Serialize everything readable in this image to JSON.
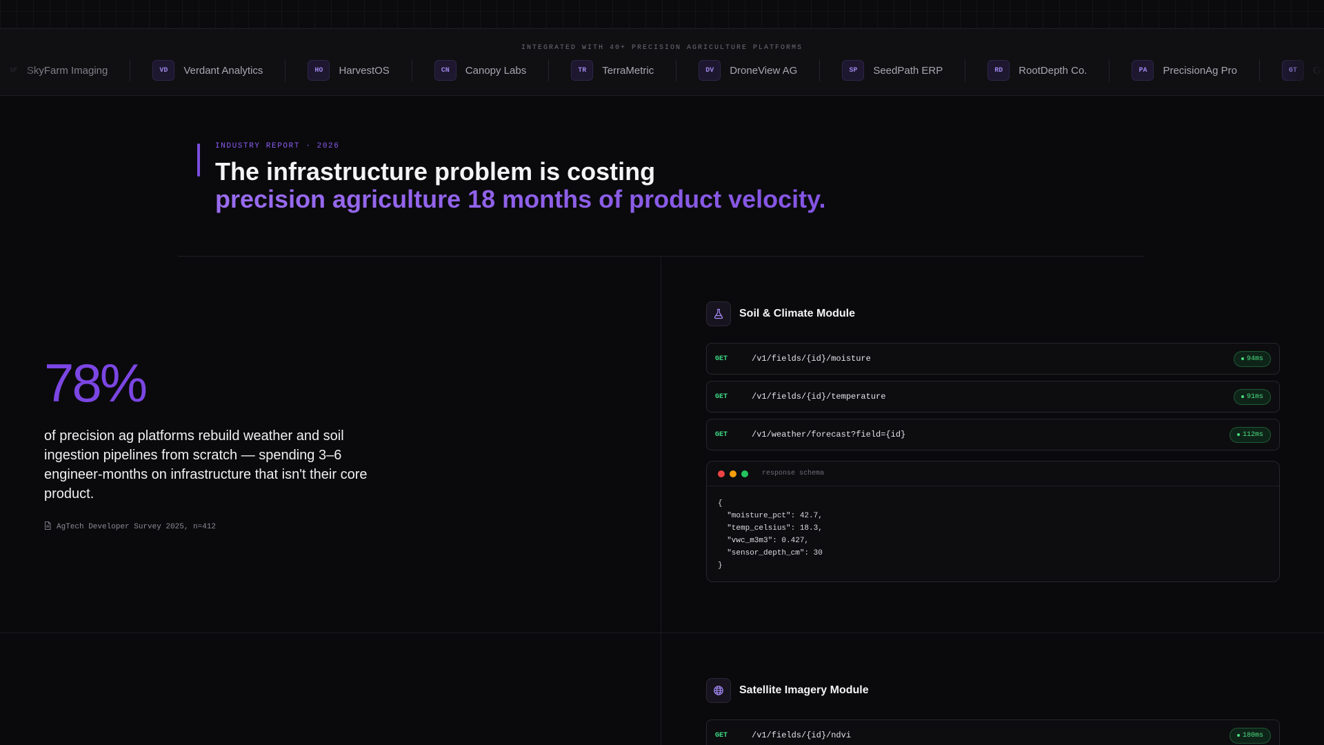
{
  "partners": {
    "caption": "INTEGRATED WITH 40+ PRECISION AGRICULTURE PLATFORMS",
    "items": [
      {
        "initials": "SF",
        "name": "SkyFarm Imaging"
      },
      {
        "initials": "VD",
        "name": "Verdant Analytics"
      },
      {
        "initials": "HO",
        "name": "HarvestOS"
      },
      {
        "initials": "CN",
        "name": "Canopy Labs"
      },
      {
        "initials": "TR",
        "name": "TerraMetric"
      },
      {
        "initials": "DV",
        "name": "DroneView AG"
      },
      {
        "initials": "SP",
        "name": "SeedPath ERP"
      },
      {
        "initials": "RD",
        "name": "RootDepth Co."
      },
      {
        "initials": "PA",
        "name": "PrecisionAg Pro"
      },
      {
        "initials": "GT",
        "name": "GrowTrack"
      }
    ]
  },
  "hero": {
    "eyebrow": "INDUSTRY REPORT · 2026",
    "title_line1": "The infrastructure problem is costing",
    "title_line2": "precision agriculture 18 months of product velocity."
  },
  "stat": {
    "value": "78%",
    "description": "of precision ag platforms rebuild weather and soil ingestion pipelines from scratch — spending 3–6 engineer-months on infrastructure that isn't their core product.",
    "source": "AgTech Developer Survey 2025, n=412"
  },
  "modules": [
    {
      "title": "Soil & Climate Module",
      "icon": "flask-icon",
      "endpoints": [
        {
          "method": "GET",
          "path": "/v1/fields/{id}/moisture",
          "latency": "94ms"
        },
        {
          "method": "GET",
          "path": "/v1/fields/{id}/temperature",
          "latency": "91ms"
        },
        {
          "method": "GET",
          "path": "/v1/weather/forecast?field={id}",
          "latency": "112ms"
        }
      ],
      "schema": {
        "title": "response schema",
        "body": "{\n  \"moisture_pct\": 42.7,\n  \"temp_celsius\": 18.3,\n  \"vwc_m3m3\": 0.427,\n  \"sensor_depth_cm\": 30\n}"
      }
    },
    {
      "title": "Satellite Imagery Module",
      "icon": "globe-icon",
      "endpoints": [
        {
          "method": "GET",
          "path": "/v1/fields/{id}/ndvi",
          "latency": "180ms"
        }
      ]
    }
  ],
  "colors": {
    "accent": "#7b46e3",
    "accent_light": "#9a6cf0",
    "success": "#4ade80",
    "background": "#0a0a0c",
    "window_dots": [
      "#ef4444",
      "#f59e0b",
      "#22c55e"
    ]
  }
}
